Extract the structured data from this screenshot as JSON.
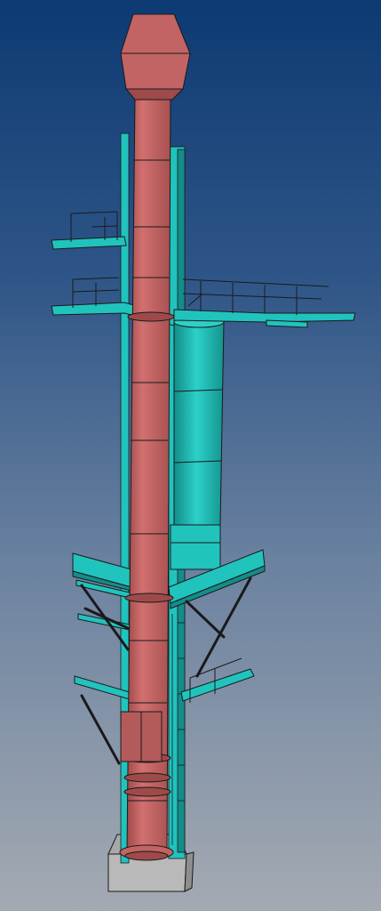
{
  "scene": {
    "type": "3d-cad-render",
    "subject": "industrial-chimney-stack",
    "background": {
      "top": "#0d3a73",
      "mid": "#6b82a0",
      "bottom": "#a4aab2"
    }
  },
  "colors": {
    "stack": "#c26464",
    "stack_shade": "#9e4a4a",
    "structure": "#21c3bd",
    "structure_dark": "#138d89",
    "edge": "#1a1a1a",
    "foundation": "#b9b9b9",
    "foundation_shade": "#8e8e8e"
  }
}
